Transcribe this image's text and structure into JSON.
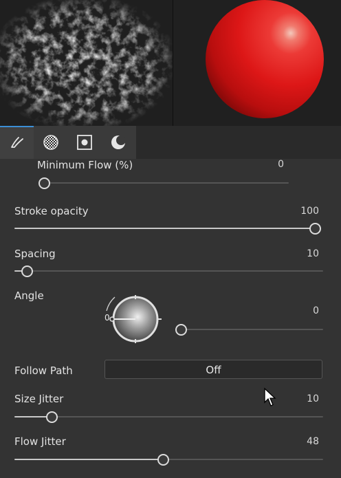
{
  "tabs": [
    {
      "icon": "brush-icon"
    },
    {
      "icon": "texture-icon"
    },
    {
      "icon": "mask-icon"
    },
    {
      "icon": "moon-icon"
    }
  ],
  "settings": {
    "minimum_flow": {
      "label": "Minimum Flow (%)",
      "value": "0",
      "fraction": 0.0
    },
    "stroke_opacity": {
      "label": "Stroke opacity",
      "value": "100",
      "fraction": 1.0
    },
    "spacing": {
      "label": "Spacing",
      "value": "10",
      "fraction": 0.04
    },
    "angle": {
      "label": "Angle",
      "value": "0",
      "dial_label": "0",
      "fraction": 0.0
    },
    "follow_path": {
      "label": "Follow Path",
      "value": "Off"
    },
    "size_jitter": {
      "label": "Size Jitter",
      "value": "10",
      "fraction": 0.12
    },
    "flow_jitter": {
      "label": "Flow Jitter",
      "value": "48",
      "fraction": 0.48
    }
  },
  "colors": {
    "accent": "#3c8fd6",
    "sphere": "#e01e1e",
    "panel_bg": "#333333"
  }
}
